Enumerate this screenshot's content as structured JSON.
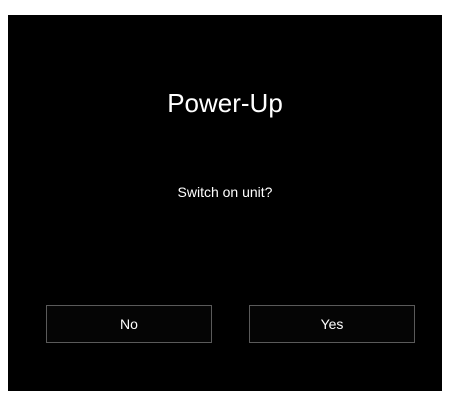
{
  "dialog": {
    "title": "Power-Up",
    "message": "Switch on unit?",
    "buttons": {
      "no_label": "No",
      "yes_label": "Yes"
    }
  },
  "colors": {
    "background": "#000000",
    "text": "#ffffff",
    "button_border": "#5a5a5a"
  }
}
